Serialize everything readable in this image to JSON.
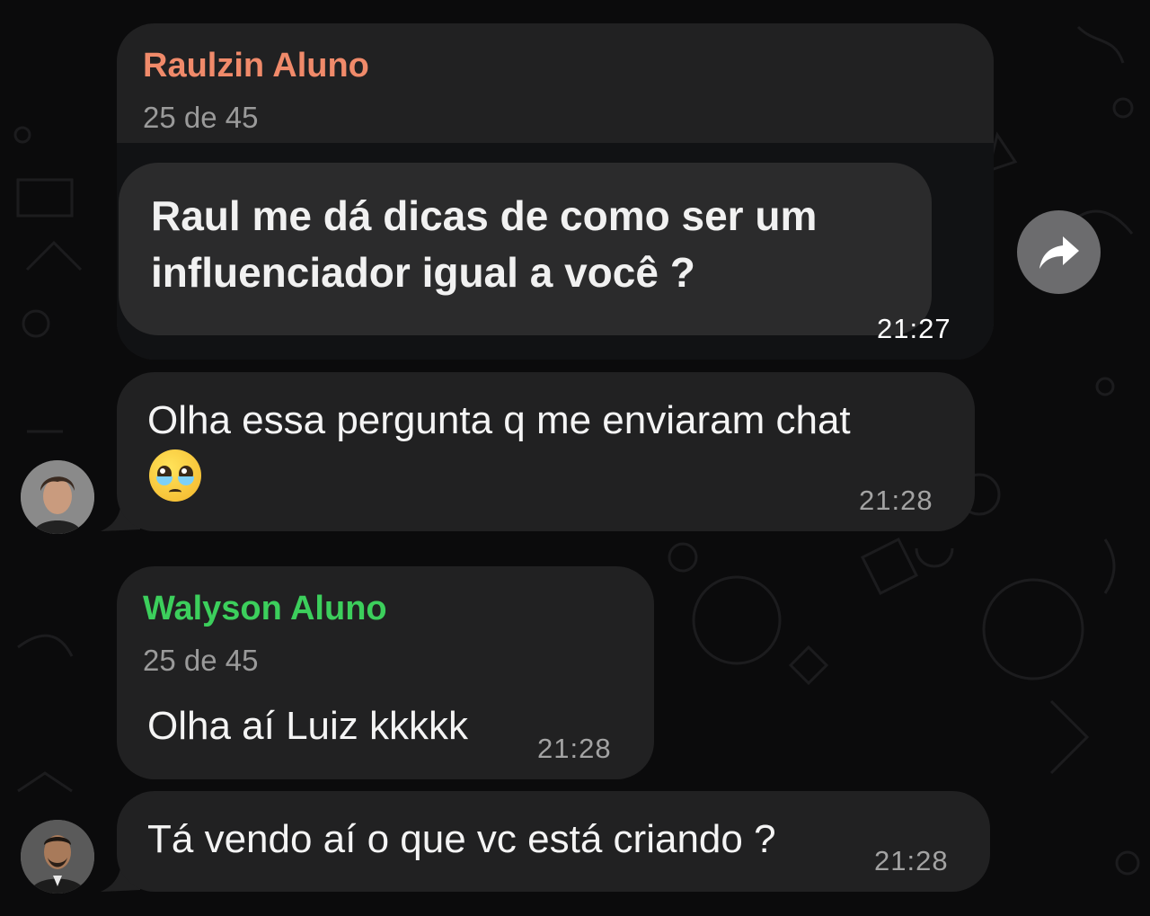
{
  "messages": [
    {
      "sender": "Raulzin Aluno",
      "sender_color": "#f08a6a",
      "sub": "25 de 45",
      "quoted_text": "Raul me dá dicas de como ser um influenciador igual a você ?",
      "time": "21:27"
    },
    {
      "text": "Olha essa pergunta q me enviaram chat",
      "emoji": "🥹",
      "time": "21:28"
    },
    {
      "sender": "Walyson Aluno",
      "sender_color": "#3ccf5c",
      "sub": "25 de 45",
      "text": "Olha aí Luiz kkkkk",
      "time": "21:28"
    },
    {
      "text": "Tá vendo aí o que vc está criando ?",
      "time": "21:28"
    }
  ],
  "icons": {
    "forward": "forward-arrow-icon"
  }
}
